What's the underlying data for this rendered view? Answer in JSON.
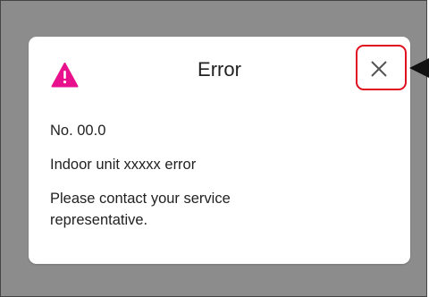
{
  "dialog": {
    "title": "Error",
    "code": "No. 00.0",
    "message": "Indoor unit xxxxx error",
    "instruction": "Please contact your service representative.",
    "icon": "warning-triangle-icon",
    "close_icon": "close-icon"
  },
  "colors": {
    "overlay": "#8c8c8c",
    "dialog_background": "#ffffff",
    "warning_accent": "#e8108c",
    "highlight": "#e01020"
  }
}
